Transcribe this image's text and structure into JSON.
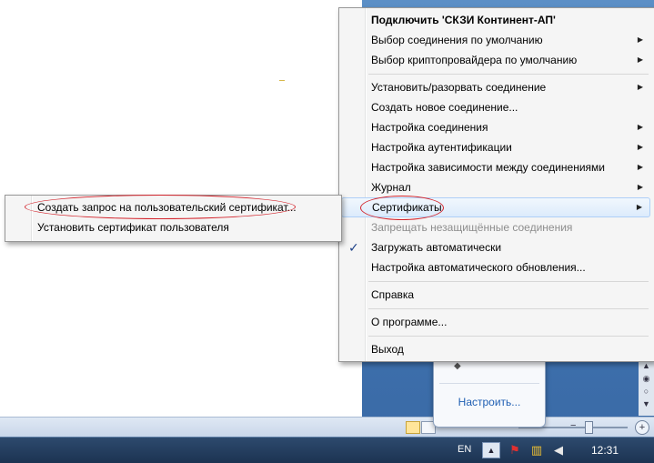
{
  "context_menu": {
    "items": [
      {
        "label": "Подключить 'СКЗИ Континент-АП'",
        "bold": true
      },
      {
        "label": "Выбор соединения по умолчанию",
        "submenu": true
      },
      {
        "label": "Выбор криптопровайдера по умолчанию",
        "submenu": true
      },
      {
        "label": "Установить/разорвать соединение",
        "submenu": true
      },
      {
        "label": "Создать новое соединение..."
      },
      {
        "label": "Настройка соединения",
        "submenu": true
      },
      {
        "label": "Настройка аутентификации",
        "submenu": true
      },
      {
        "label": "Настройка зависимости между соединениями",
        "submenu": true
      },
      {
        "label": "Журнал",
        "submenu": true
      },
      {
        "label": "Сертификаты",
        "submenu": true,
        "highlighted": true
      },
      {
        "label": "Запрещать незащищённые соединения",
        "disabled": true
      },
      {
        "label": "Загружать автоматически",
        "checked": true
      },
      {
        "label": "Настройка автоматического обновления..."
      },
      {
        "label": "Справка"
      },
      {
        "label": "О программе..."
      },
      {
        "label": "Выход"
      }
    ]
  },
  "certificates_submenu": {
    "items": [
      {
        "label": "Создать запрос на пользовательский сертификат..."
      },
      {
        "label": "Установить сертификат пользователя"
      }
    ]
  },
  "tray_popup": {
    "customize_label": "Настроить..."
  },
  "taskbar": {
    "language": "EN",
    "show_hidden_label": "▲",
    "clock": "12:31"
  },
  "symbols": {
    "arrow": "▶",
    "check": "✓",
    "plus": "+",
    "minus": "−"
  },
  "colors": {
    "highlight_border": "#aecff7",
    "annotation_ellipse": "#d3242c",
    "link": "#1f5fb3"
  },
  "icons": [
    "submenu-arrow-icon",
    "checkmark-icon",
    "flag-icon",
    "network-icon",
    "volume-muted-icon"
  ]
}
